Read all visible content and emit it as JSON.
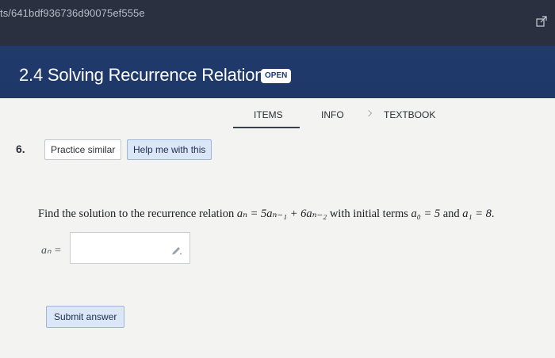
{
  "browser": {
    "url": "ts/641bdf936736d90075ef555e"
  },
  "header": {
    "title": "2.4 Solving Recurrence Relations",
    "badge": "OPEN"
  },
  "tabs": [
    {
      "label": "ITEMS",
      "active": true
    },
    {
      "label": "INFO",
      "active": false
    },
    {
      "label": "TEXTBOOK",
      "active": false
    }
  ],
  "question": {
    "number": "6.",
    "practice_label": "Practice similar",
    "help_label": "Help me with this",
    "text_prefix": "Find the solution to the recurrence relation ",
    "relation": "aₙ = 5aₙ₋₁ + 6aₙ₋₂",
    "text_middle": " with initial terms ",
    "initial_a0": "a₀ = 5",
    "text_and": " and ",
    "initial_a1": "a₁ = 8",
    "text_suffix": ".",
    "answer_label": "aₙ =",
    "answer_value": "",
    "submit_label": "Submit answer"
  },
  "colors": {
    "topbar": "#2b3040",
    "header": "#1f3a6e",
    "accent_button": "#dbe6f7"
  },
  "icons": {
    "share": "share-icon",
    "pencil": "pencil-icon"
  }
}
